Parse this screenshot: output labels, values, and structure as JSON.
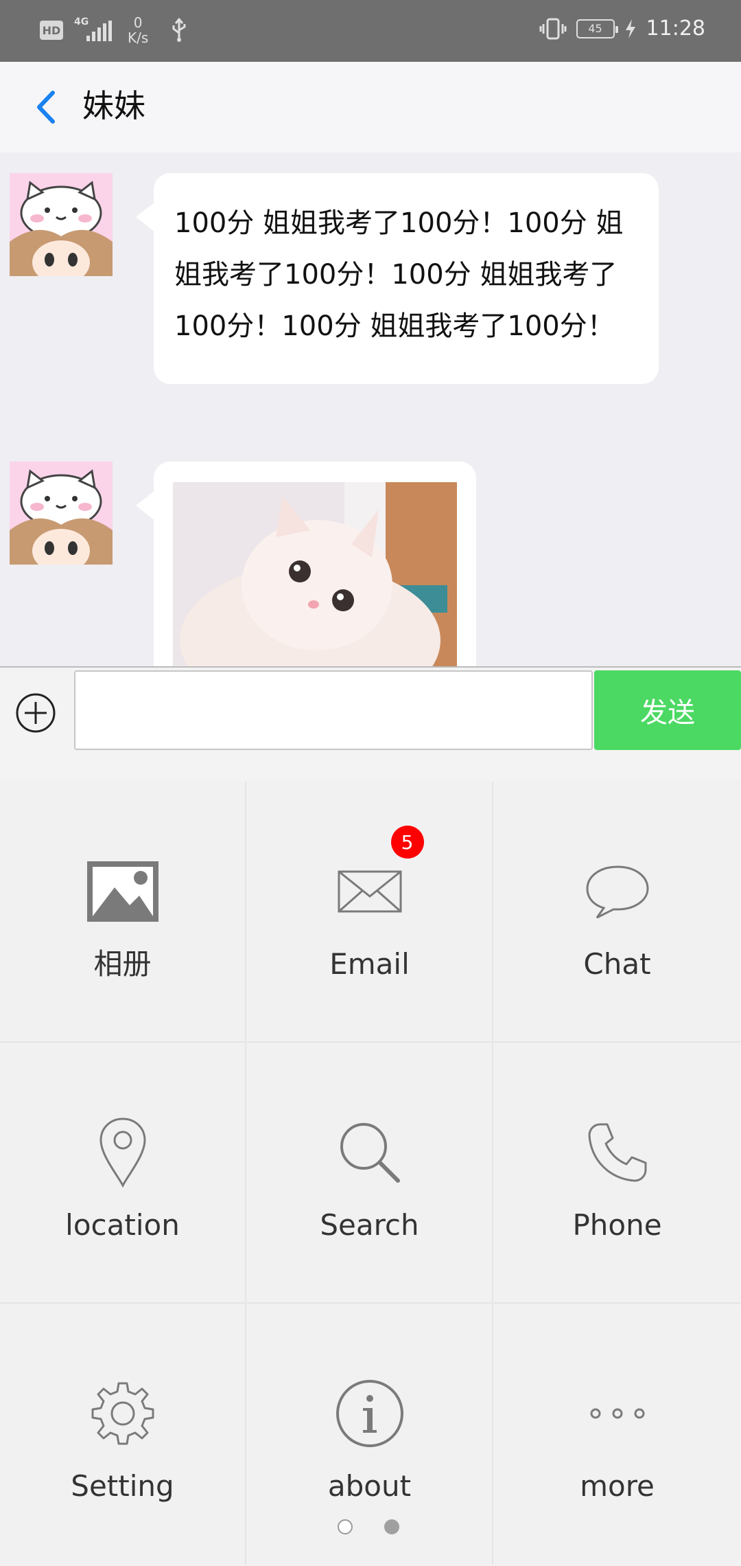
{
  "status_bar": {
    "hd": "HD",
    "network": "4G",
    "speed_value": "0",
    "speed_unit": "K/s",
    "battery": "45",
    "time": "11:28"
  },
  "header": {
    "title": "妹妹"
  },
  "messages": [
    {
      "type": "text",
      "text": "100分 姐姐我考了100分！100分 姐姐我考了100分！100分 姐姐我考了100分！100分 姐姐我考了100分！"
    },
    {
      "type": "image"
    }
  ],
  "input": {
    "value": "",
    "send_label": "发送"
  },
  "grid": {
    "items": [
      {
        "label": "相册",
        "icon": "album-icon"
      },
      {
        "label": "Email",
        "icon": "email-icon",
        "badge": "5"
      },
      {
        "label": "Chat",
        "icon": "chat-icon"
      },
      {
        "label": "location",
        "icon": "location-icon"
      },
      {
        "label": "Search",
        "icon": "search-icon"
      },
      {
        "label": "Phone",
        "icon": "phone-icon"
      },
      {
        "label": "Setting",
        "icon": "setting-icon"
      },
      {
        "label": "about",
        "icon": "about-icon"
      },
      {
        "label": "more",
        "icon": "more-icon"
      }
    ]
  },
  "pager": {
    "current_page": 1,
    "total_pages": 2
  },
  "colors": {
    "accent": "#1a82f0",
    "send": "#4cd963",
    "badge": "#ff0000"
  }
}
